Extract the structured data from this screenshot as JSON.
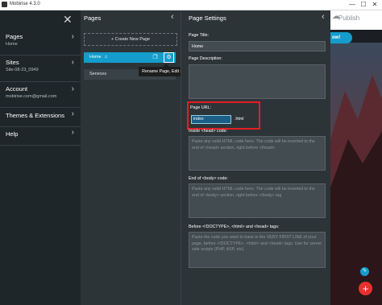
{
  "app": {
    "title": "Mobirise 4.3.0"
  },
  "window": {
    "minimize": "—",
    "maximize": "☐",
    "close": "✕"
  },
  "menu": {
    "close_icon": "close-icon",
    "items": [
      {
        "label": "Pages",
        "sub": "Home"
      },
      {
        "label": "Sites",
        "sub": "Site-08-23_0949"
      },
      {
        "label": "Account",
        "sub": "mobirise.com@gmail.com"
      },
      {
        "label": "Themes & Extensions",
        "sub": ""
      },
      {
        "label": "Help",
        "sub": ""
      }
    ],
    "chevron": "›"
  },
  "pages_panel": {
    "header": "Pages",
    "create_label": "+ Create New Page",
    "pages": [
      {
        "label": "Home"
      },
      {
        "label": "Services"
      }
    ],
    "tooltip": "Rename Page, Edit Meta Tags"
  },
  "settings": {
    "header": "Page Settings",
    "title_label": "Page Title:",
    "title_value": "Home",
    "description_label": "Page Description:",
    "description_value": "",
    "url_label": "Page URL:",
    "url_value": "index",
    "url_ext": ".html",
    "head_label": "Inside <head> code:",
    "head_placeholder": "Paste any valid HTML code here. The code will be inserted to the end of <head> section, right before </head>",
    "body_label": "End of <body> code:",
    "body_placeholder": "Paste any valid HTML code here. The code will be inserted to the end of <body> section, right before </body> tag",
    "doctype_label": "Before <!DOCTYPE>, <html> and <head> tags:",
    "doctype_placeholder": "Paste the code you want to have in the VERY FIRST LINE of your page, before <!DOCTYPE>, <html> and <head> tags. Use for server side scripts (PHP, ASP, etc)."
  },
  "preview": {
    "publish_label": "Publish",
    "button_label": "ow!",
    "add_icon": "+",
    "edit_icon": "✎"
  },
  "colors": {
    "accent": "#149dcc",
    "highlight": "#e31e24",
    "fab": "#e8312d"
  }
}
